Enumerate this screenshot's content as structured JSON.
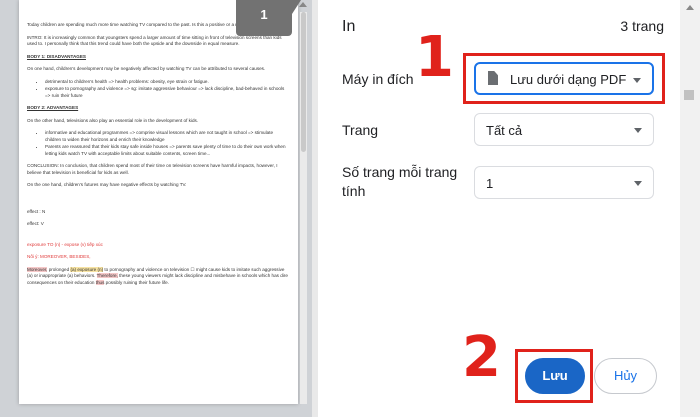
{
  "preview": {
    "page_badge": "1",
    "doc": {
      "intro": "Today children are spending much more time watching TV compared to the past. Is this a positive or a negative change?",
      "intro2": "INTRO: It is increasingly common that youngsters spend a larger amount of time sitting in front of television screens than kids used to. I personally think that this trend could have both the upside and the downside in equal measure.",
      "body1_head": "BODY 1: DISADVANTAGES",
      "body1_p": "On one hand, children’s development may be negatively affected by watching TV can be attributed to several causes.",
      "body1_items": [
        "detrimental to children’s health => health problems: obesity, eye strain or fatigue.",
        "exposure to pornography and violence => sg: imitate aggressive behaviour => lack discipline, bad-behaved in schools => ruin their future"
      ],
      "body2_head": "BODY 2: ADVANTAGES",
      "body2_p": "On the other hand, televisions also play an essential role in the development of kids.",
      "body2_items": [
        "informative and educational programmes => comprise visual lessons which are not taught in school => stimulate children to widen their horizons and enrich their knowledge",
        "Parents are reassured that their kids stay safe inside houses => parents save plenty of time to do their own work when letting kids watch TV with acceptable limits about suitable contents, screen time..."
      ],
      "conclusion": "CONCLUSION: In conclusion, that children spend most of their time on television screens have harmful impacts, however, I believe that television is beneficial for kids as well.",
      "onehand": "On the one hand, children’s futures may have negative effects by watching TV.",
      "effect_n": "effect : N",
      "effect_v": "effect: V",
      "red1": "exposure TO (n) - expose (v) tiếp xúc",
      "red2": "Nối ý: MOREOVER, BESIDES,",
      "final_a": "Moreover,",
      "final_b": " prolonged ",
      "final_c": "(a) exposure (n)",
      "final_d": " to pornography and violence on television ",
      "final_e": "☐",
      "final_f": " might cause kids to imitate such aggressive (a) or inappropriate (a) behaviors. ",
      "final_g": "Therefore,",
      "final_h": " these young viewers might lack discipline and misbehave in schools which has dire consequences on their education",
      "final_i": "thus",
      "final_j": " possibly ruining their future life."
    }
  },
  "panel": {
    "title": "In",
    "page_count": "3 trang",
    "destination_label": "Máy in đích",
    "destination_value": "Lưu dưới dạng PDF",
    "pages_label": "Trang",
    "pages_value": "Tất cả",
    "per_sheet_label": "Số trang mỗi trang tính",
    "per_sheet_value": "1",
    "save_label": "Lưu",
    "cancel_label": "Hủy",
    "step1": "1",
    "step2": "2"
  },
  "colors": {
    "accent": "#1a73e8",
    "annotation": "#e0221b"
  }
}
